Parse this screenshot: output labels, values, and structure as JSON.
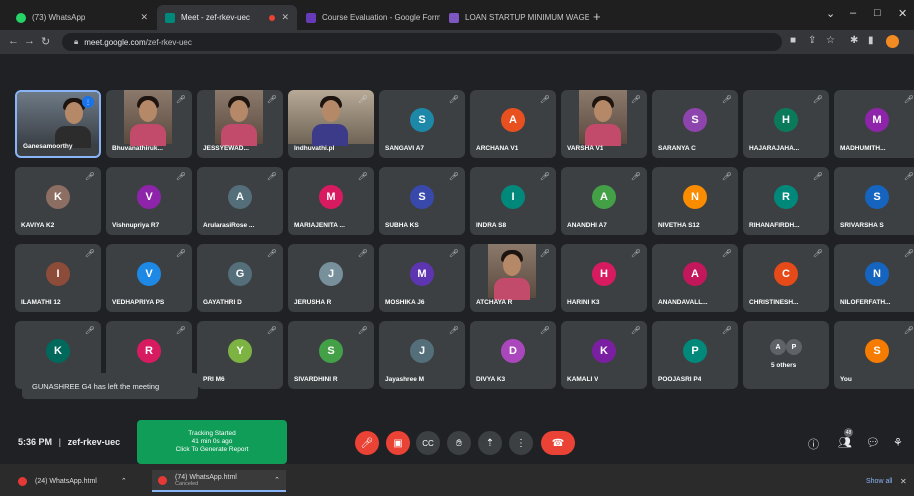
{
  "browser": {
    "tabs": [
      {
        "title": "(73) WhatsApp",
        "color": "#25d366",
        "active": false
      },
      {
        "title": "Meet - zef-rkev-uec",
        "color": "#00897b",
        "active": true
      },
      {
        "title": "Course Evaluation - Google Form",
        "color": "#673ab7",
        "active": false
      },
      {
        "title": "LOAN STARTUP MINIMUM WAGE",
        "color": "#7e57c2",
        "active": false
      }
    ],
    "new_tab": "+",
    "url_host": "meet.google.com",
    "url_path": "/zef-rkev-uec"
  },
  "tiles": [
    {
      "name": "Ganesamoorthy",
      "type": "self"
    },
    {
      "name": "Bhuvanathiruk...",
      "type": "photo"
    },
    {
      "name": "JESSYEWAD...",
      "type": "photo"
    },
    {
      "name": "Indhuvathi.pl",
      "type": "widephoto"
    },
    {
      "name": "SANGAVI A7",
      "initial": "S",
      "color": "#1e88a8"
    },
    {
      "name": "ARCHANA V1",
      "initial": "A",
      "color": "#e8501f"
    },
    {
      "name": "VARSHA V1",
      "type": "photo"
    },
    {
      "name": "SARANYA C",
      "initial": "S",
      "color": "#8e44ad"
    },
    {
      "name": "HAJARAJAHA...",
      "initial": "H",
      "color": "#0b7a5a"
    },
    {
      "name": "MADHUMITH...",
      "initial": "M",
      "color": "#8e24aa"
    },
    {
      "name": "KAVIYA K2",
      "initial": "K",
      "color": "#8d6e63"
    },
    {
      "name": "Vishnupriya R7",
      "initial": "V",
      "color": "#8e24aa"
    },
    {
      "name": "ArularasiRose ...",
      "initial": "A",
      "color": "#546e7a"
    },
    {
      "name": "MARIAJENITA ...",
      "initial": "M",
      "color": "#d81b60"
    },
    {
      "name": "SUBHA KS",
      "initial": "S",
      "color": "#3949ab"
    },
    {
      "name": "INDRA S8",
      "initial": "I",
      "color": "#00897b"
    },
    {
      "name": "ANANDHI A7",
      "initial": "A",
      "color": "#43a047"
    },
    {
      "name": "NIVETHA S12",
      "initial": "N",
      "color": "#fb8c00"
    },
    {
      "name": "RIHANAFIRDH...",
      "initial": "R",
      "color": "#00897b"
    },
    {
      "name": "SRIVARSHA S",
      "initial": "S",
      "color": "#1565c0"
    },
    {
      "name": "ILAMATHI 12",
      "initial": "I",
      "color": "#8d4b3a"
    },
    {
      "name": "VEDHAPRIYA PS",
      "initial": "V",
      "color": "#1e88e5"
    },
    {
      "name": "GAYATHRI D",
      "initial": "G",
      "color": "#546e7a"
    },
    {
      "name": "JERUSHA R",
      "initial": "J",
      "color": "#78909c"
    },
    {
      "name": "MOSHIKA J6",
      "initial": "M",
      "color": "#5e35b1"
    },
    {
      "name": "ATCHAYA R",
      "type": "photo"
    },
    {
      "name": "HARINI K3",
      "initial": "H",
      "color": "#d81b60"
    },
    {
      "name": "ANANDAVALL...",
      "initial": "A",
      "color": "#c2185b"
    },
    {
      "name": "CHRISTINESH...",
      "initial": "C",
      "color": "#e64a19"
    },
    {
      "name": "NILOFERFATH...",
      "initial": "N",
      "color": "#1565c0"
    },
    {
      "name": "",
      "initial": "K",
      "color": "#00695c"
    },
    {
      "name": "",
      "initial": "R",
      "color": "#d81b60"
    },
    {
      "name": "PRI M6",
      "initial": "Y",
      "color": "#7cb342"
    },
    {
      "name": "SIVARDHINI R",
      "initial": "S",
      "color": "#43a047"
    },
    {
      "name": "Jayashree M",
      "initial": "J",
      "color": "#546e7a"
    },
    {
      "name": "DIVYA K3",
      "initial": "D",
      "color": "#ab47bc"
    },
    {
      "name": "KAMALI V",
      "initial": "K",
      "color": "#7b1fa2"
    },
    {
      "name": "POOJASRI P4",
      "initial": "P",
      "color": "#00897b"
    },
    {
      "name": "5 others",
      "type": "others",
      "minis": [
        "A",
        "P"
      ]
    },
    {
      "name": "You",
      "initial": "S",
      "color": "#f57c00"
    }
  ],
  "toast": "GUNASHREE G4 has left the meeting",
  "meeting": {
    "time": "5:36 PM",
    "separator": "|",
    "code": "zef-rkev-uec"
  },
  "tracking": {
    "line1": "Tracking Started",
    "line2": "41 min 0s ago",
    "line3": "Click To Generate Report"
  },
  "people_count": "48",
  "taskbar": {
    "item1": "(24) WhatsApp.html",
    "item2": "(74) WhatsApp.html",
    "item2_sub": "Canceled",
    "show_all": "Show all"
  }
}
